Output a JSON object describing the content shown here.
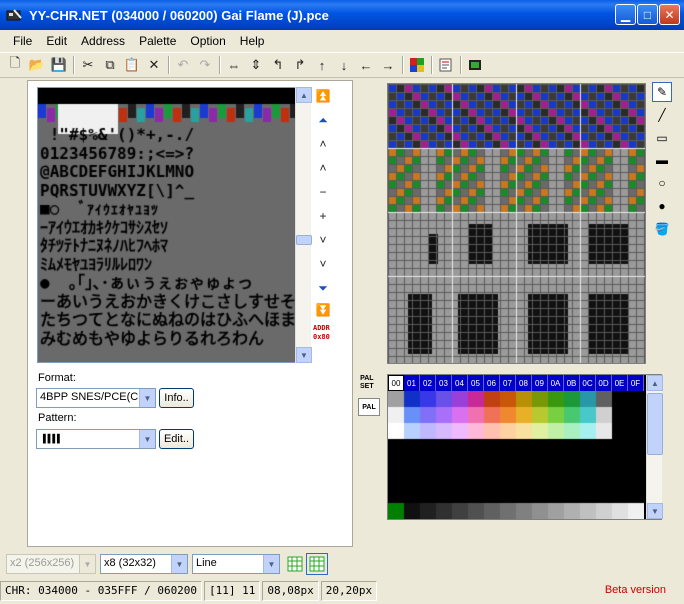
{
  "window": {
    "title": "YY-CHR.NET (034000 / 060200) Gai Flame (J).pce"
  },
  "menu": {
    "items": [
      "File",
      "Edit",
      "Address",
      "Palette",
      "Option",
      "Help"
    ]
  },
  "left": {
    "format_label": "Format:",
    "format_value": "4BPP SNES/PCE(C",
    "info_button": "Info..",
    "pattern_label": "Pattern:",
    "pattern_value": "▐▐▐▐",
    "edit_button": "Edit..",
    "addr_text": "ADDR",
    "addr_value": "0x80"
  },
  "palette": {
    "palset_label": "PAL\nSET",
    "pal_button": "PAL",
    "indices": [
      "00",
      "01",
      "02",
      "03",
      "04",
      "05",
      "06",
      "07",
      "08",
      "09",
      "0A",
      "0B",
      "0C",
      "0D",
      "0E",
      "0F"
    ],
    "row1": [
      "#a0a0a0",
      "#1030c8",
      "#3838e8",
      "#6850e8",
      "#9840d8",
      "#c82898",
      "#c04010",
      "#c85808",
      "#b89008",
      "#789808",
      "#389810",
      "#1c9838",
      "#2898a8",
      "#606060",
      "#000000",
      "#000000"
    ],
    "row2": [
      "#f0f0f0",
      "#6890f8",
      "#8070f8",
      "#a870f8",
      "#d870f0",
      "#f070b0",
      "#f07058",
      "#f08830",
      "#e8b028",
      "#b8c830",
      "#78d040",
      "#48c870",
      "#48c8c8",
      "#d0d0d0",
      "#000000",
      "#000000"
    ],
    "row3": [
      "#ffffff",
      "#b8d0ff",
      "#c0b8ff",
      "#d8b8ff",
      "#f0b8ff",
      "#ffb8d8",
      "#ffc0b0",
      "#ffd0a0",
      "#f8e0a0",
      "#e0f0a0",
      "#c0f0a8",
      "#a8f0c0",
      "#a8f0f0",
      "#e8e8e8",
      "#000000",
      "#000000"
    ],
    "row_bottom": [
      "#008000",
      "#101010",
      "#202020",
      "#303030",
      "#404040",
      "#505050",
      "#606060",
      "#707070",
      "#808080",
      "#909090",
      "#a0a0a0",
      "#b0b0b0",
      "#c0c0c0",
      "#d0d0d0",
      "#e0e0e0",
      "#f0f0f0"
    ]
  },
  "bottom": {
    "zoom_value": "x2 (256x256)",
    "size_value": "x8 (32x32)",
    "tool_value": "Line"
  },
  "status": {
    "address": "CHR: 034000 - 035FFF / 060200",
    "index": "[11] 11",
    "cursor": "08,08px",
    "size": "20,20px",
    "beta": "Beta version"
  },
  "colors": {
    "title_bar": "#0054e3",
    "accent_red": "#cc0000"
  }
}
